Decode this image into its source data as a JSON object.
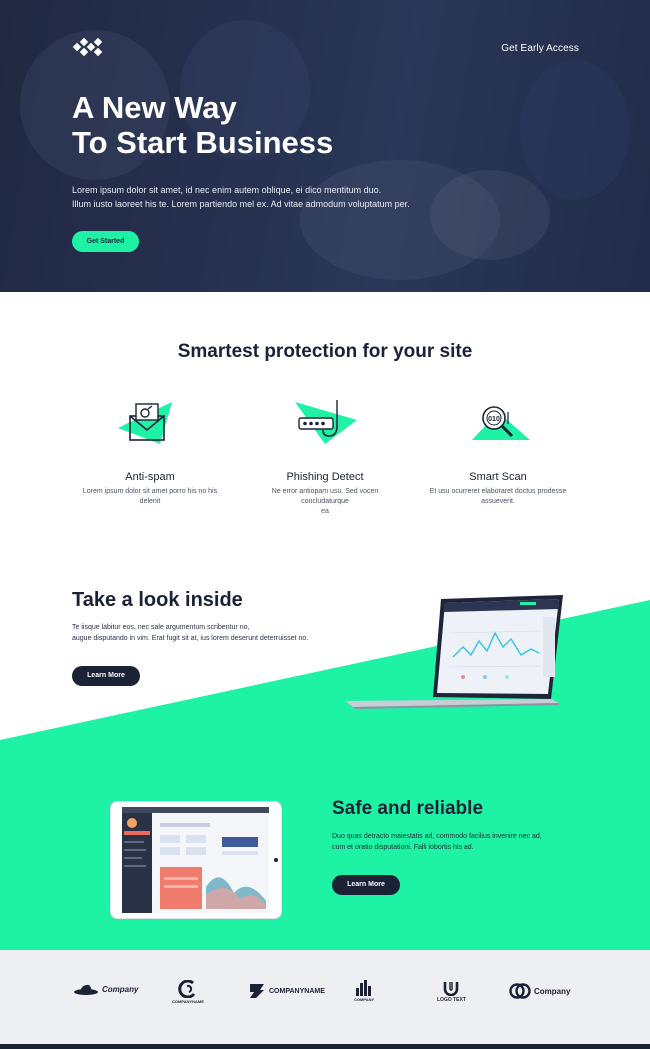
{
  "header": {
    "logo_icon": "diamond-grid-logo",
    "nav_link": "Get Early Access"
  },
  "hero": {
    "title_line1": "A New Way",
    "title_line2": "To Start Business",
    "desc_line1": "Lorem ipsum dolor sit amet, id nec enim autem oblique, ei dico mentitum duo.",
    "desc_line2": "Illum iusto laoreet his te. Lorem partiendo mel ex. Ad vitae admodum voluptatum per.",
    "cta": "Get Started"
  },
  "features": {
    "title": "Smartest protection for your site",
    "items": [
      {
        "icon": "envelope-icon",
        "title": "Anti-spam",
        "desc_line1": "Lorem ipsum dolor sit amet porro his no his",
        "desc_line2": "delenit"
      },
      {
        "icon": "password-hook-icon",
        "title": "Phishing Detect",
        "desc_line1": "Ne error antiopam usu. Sed vocen concludaturque",
        "desc_line2": "ea"
      },
      {
        "icon": "magnifier-scan-icon",
        "title": "Smart Scan",
        "desc_line1": "Et usu ocurreret elaboraret doctus prodesse",
        "desc_line2": "assueverit."
      }
    ]
  },
  "inside": {
    "title": "Take a look inside",
    "desc_line1": "Te iisque labitur eos, nec sale argumentum scribentur no,",
    "desc_line2": "augue disputando in vim. Erat fugit sit at, ius lorem deserunt deterruisset no.",
    "button": "Learn More"
  },
  "safe": {
    "title": "Safe and reliable",
    "desc_line1": "Duo quas detracto maiestatis ad, commodo facilius invenire nec ad,",
    "desc_line2": "cum et oratio disputationi. Falli lobortis his ad.",
    "button": "Learn More"
  },
  "logos": [
    {
      "icon": "hat-logo-icon",
      "name": "Company"
    },
    {
      "icon": "swirl-logo-icon",
      "name": "COMPANYNAME"
    },
    {
      "icon": "s-logo-icon",
      "name": "COMPANYNAME"
    },
    {
      "icon": "city-logo-icon",
      "name": "COMPANY"
    },
    {
      "icon": "u-logo-icon",
      "name": "LOGO TEXT"
    },
    {
      "icon": "rings-logo-icon",
      "name": "Company"
    }
  ],
  "colors": {
    "accent": "#1ef2a4",
    "dark": "#1b2236",
    "hero_bg": "#2f3a5c",
    "logos_bg": "#eeeff2"
  }
}
